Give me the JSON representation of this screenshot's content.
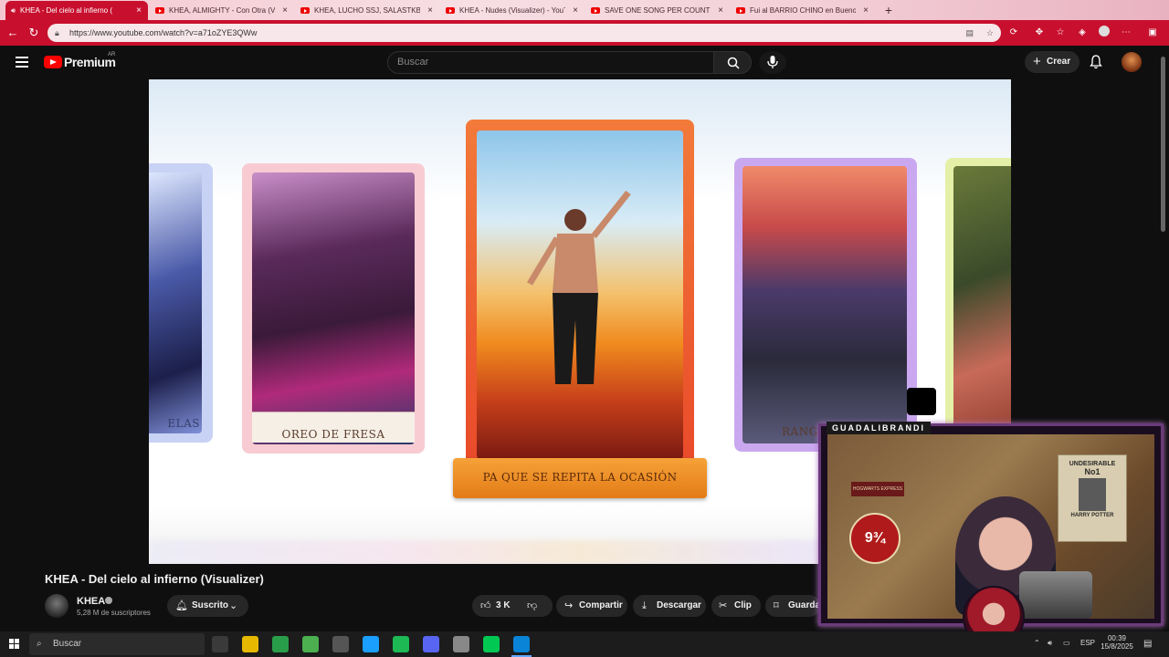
{
  "browser": {
    "tabs": [
      {
        "title": "KHEA - Del cielo al infierno (",
        "active": true
      },
      {
        "title": "KHEA, ALMIGHTY - Con Otra (Visu",
        "active": false
      },
      {
        "title": "KHEA, LUCHO SSJ, SALASTKBROK",
        "active": false
      },
      {
        "title": "KHEA - Nudes (Visualizer) - YouTu",
        "active": false
      },
      {
        "title": "SAVE ONE SONG PER COUNTRY",
        "active": false
      },
      {
        "title": "Fui al BARRIO CHINO en Buenos",
        "active": false
      }
    ],
    "new_tab": "+",
    "url": "https://www.youtube.com/watch?v=a71oZYE3QWw",
    "accent_color": "#c8102e"
  },
  "header": {
    "logo_text": "Premium",
    "country_code": "AR",
    "search_placeholder": "Buscar",
    "create_label": "Crear",
    "create_plus": "+"
  },
  "video": {
    "cards": [
      {
        "label": "ELAS"
      },
      {
        "label": "OREO DE FRESA"
      },
      {
        "label": "PA QUE SE REPITA LA OCASIÓN"
      },
      {
        "label": "RANGE"
      },
      {
        "label": ""
      }
    ]
  },
  "video_info": {
    "title": "KHEA - Del cielo al infierno (Visualizer)",
    "channel_name": "KHEA",
    "subscribers": "5,28 M de suscriptores",
    "subscribe_label": "Suscrito",
    "likes": "3 K",
    "share_label": "Compartir",
    "download_label": "Descargar",
    "clip_label": "Clip",
    "save_label": "Guardar"
  },
  "webcam": {
    "streamer_name": "GUADALIBRANDI",
    "poster_undesirable": "UNDESIRABLE",
    "poster_number": "No1",
    "poster_name": "HARRY POTTER",
    "sign_hogwarts": "HOGWARTS EXPRESS",
    "sign_platform": "9¾"
  },
  "taskbar": {
    "search_placeholder": "Buscar",
    "language": "ESP",
    "time": "00:39",
    "date": "15/8/2025",
    "app_colors": [
      "#3a3a3a",
      "#e6b800",
      "#2a9d4a",
      "#4caf50",
      "#555555",
      "#1a9fff",
      "#1db954",
      "#5865f2",
      "#888888",
      "#00c853",
      "#0a84d6"
    ]
  }
}
